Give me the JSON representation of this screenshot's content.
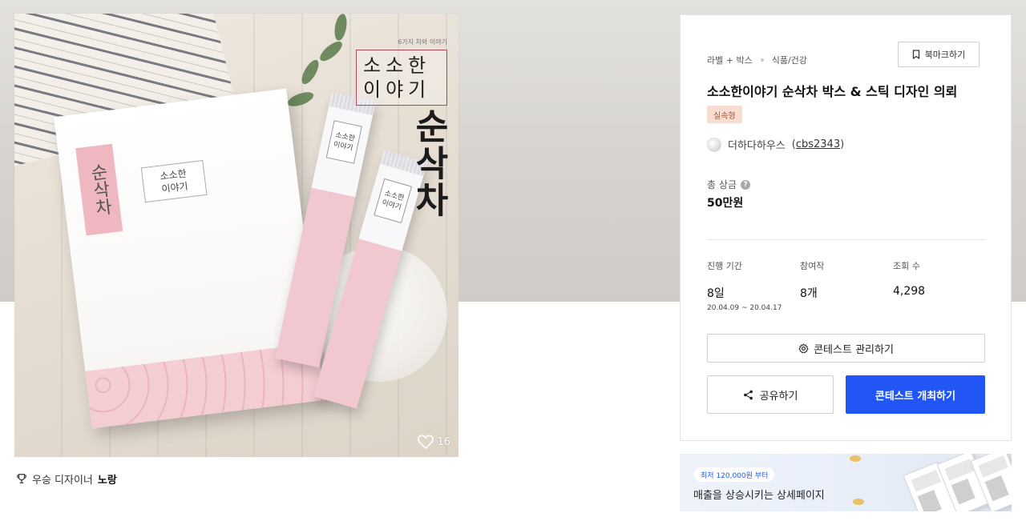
{
  "product_image": {
    "brand_small_text": "6가지 차와 이야기",
    "brand_title_line1": "소소한",
    "brand_title_line2": "이야기",
    "product_name_vertical": "순삭차",
    "box_label_vertical": "순삭차",
    "box_label_line1": "소소한",
    "box_label_line2": "이야기",
    "stick_label": "소소한 이야기",
    "like_icon": "heart-icon",
    "like_count": "16"
  },
  "winner": {
    "icon": "trophy-icon",
    "label": "우승 디자이너",
    "name": "노랑"
  },
  "panel": {
    "breadcrumb": [
      "라벨 + 박스",
      "식품/건강"
    ],
    "bookmark_label": "북마크하기",
    "title": "소소한이야기 순삭차 박스 & 스틱 디자인 의뢰",
    "badge": "실속형",
    "host_name": "더하다하우스",
    "host_id_open": "(",
    "host_id": "cbs2343",
    "host_id_close": ")",
    "prize_label": "총 상금",
    "prize_help": "?",
    "prize_value": "50만원",
    "stats": {
      "duration_label": "진행 기간",
      "duration_value": "8일",
      "duration_range": "20.04.09 ~ 20.04.17",
      "entries_label": "참여작",
      "entries_value": "8개",
      "views_label": "조회 수",
      "views_value": "4,298"
    },
    "manage_label": "콘테스트 관리하기",
    "share_label": "공유하기",
    "host_contest_label": "콘테스트 개최하기"
  },
  "ad": {
    "pill": "최저 120,000원 부터",
    "text": "매출을 상승시키는 상세페이지"
  },
  "colors": {
    "primary": "#2155f5",
    "badge_bg": "#f8ddd0",
    "badge_text": "#9a5a3e"
  }
}
